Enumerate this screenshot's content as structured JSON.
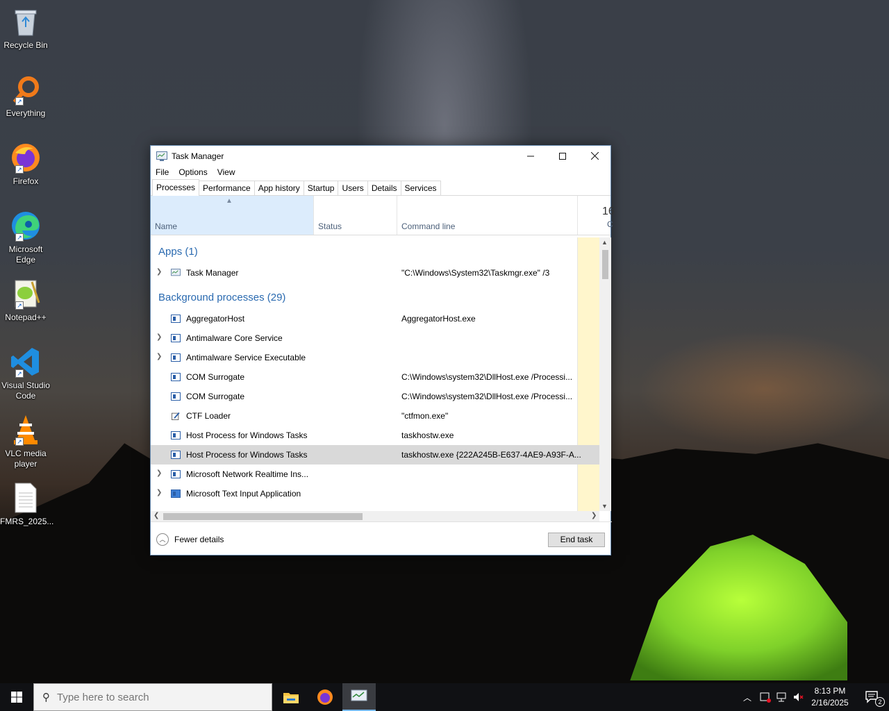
{
  "desktop": {
    "icons": [
      {
        "label": "Recycle Bin"
      },
      {
        "label": "Everything"
      },
      {
        "label": "Firefox"
      },
      {
        "label": "Microsoft Edge"
      },
      {
        "label": "Notepad++"
      },
      {
        "label": "Visual Studio Code"
      },
      {
        "label": "VLC media player"
      },
      {
        "label": "FMRS_2025..."
      }
    ]
  },
  "window": {
    "title": "Task Manager",
    "menu": [
      "File",
      "Options",
      "View"
    ],
    "tabs": [
      "Processes",
      "Performance",
      "App history",
      "Startup",
      "Users",
      "Details",
      "Services"
    ],
    "active_tab": "Processes",
    "columns": {
      "name": "Name",
      "status": "Status",
      "command": "Command line",
      "cpu_pct": "16",
      "cpu_sub": "C"
    },
    "groups": {
      "apps": "Apps (1)",
      "background": "Background processes (29)"
    },
    "app_rows": [
      {
        "name": "Task Manager",
        "command": "\"C:\\Windows\\System32\\Taskmgr.exe\" /3"
      }
    ],
    "bg_rows": [
      {
        "name": "AggregatorHost",
        "command": "AggregatorHost.exe"
      },
      {
        "name": "Antimalware Core Service",
        "command": ""
      },
      {
        "name": "Antimalware Service Executable",
        "command": ""
      },
      {
        "name": "COM Surrogate",
        "command": "C:\\Windows\\system32\\DllHost.exe /Processi..."
      },
      {
        "name": "COM Surrogate",
        "command": "C:\\Windows\\system32\\DllHost.exe /Processi..."
      },
      {
        "name": "CTF Loader",
        "command": "\"ctfmon.exe\""
      },
      {
        "name": "Host Process for Windows Tasks",
        "command": "taskhostw.exe"
      },
      {
        "name": "Host Process for Windows Tasks",
        "command": "taskhostw.exe {222A245B-E637-4AE9-A93F-A..."
      },
      {
        "name": "Microsoft Network Realtime Ins...",
        "command": ""
      },
      {
        "name": "Microsoft Text Input Application",
        "command": ""
      }
    ],
    "fewer_details": "Fewer details",
    "end_task": "End task"
  },
  "taskbar": {
    "search_placeholder": "Type here to search",
    "time": "8:13 PM",
    "date": "2/16/2025",
    "notification_count": "2"
  }
}
